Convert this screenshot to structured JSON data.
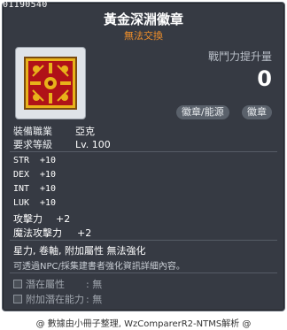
{
  "item_id": "01190540",
  "title": "黃金深淵徽章",
  "subtitle": "無法交換",
  "power_label": "戰鬥力提升量",
  "power_value": "0",
  "badges": [
    "徽章/能源",
    "徽章"
  ],
  "requirements": [
    {
      "label": "裝備職業",
      "value": "亞克"
    },
    {
      "label": "要求等級",
      "value": "Lv. 100"
    }
  ],
  "stats_mono": [
    {
      "name": "STR",
      "value": "+10"
    },
    {
      "name": "DEX",
      "value": "+10"
    },
    {
      "name": "INT",
      "value": "+10"
    },
    {
      "name": "LUK",
      "value": "+10"
    }
  ],
  "stats_text": [
    {
      "name": "攻擊力",
      "value": "+2"
    },
    {
      "name": "魔法攻擊力",
      "value": "+2"
    }
  ],
  "desc_line1": "星力, 卷軸, 附加屬性 無法強化",
  "desc_line2": "可透過NPC/採集建書者強化資訊詳細內容。",
  "potentials": [
    {
      "label": "潛在屬性",
      "value": ": 無"
    },
    {
      "label": "附加潛在能力",
      "value": ": 無"
    }
  ],
  "footer": "@ 數據由小冊子整理, WzComparerR2-NTMS解析 @",
  "colors": {
    "background": "#363a43",
    "subtitle": "#f08f2a",
    "icon_red": "#c0141a",
    "icon_gold": "#e8b21a"
  }
}
